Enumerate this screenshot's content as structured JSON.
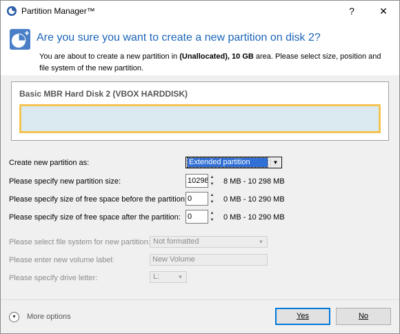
{
  "window": {
    "title": "Partition Manager™",
    "help_glyph": "?",
    "close_glyph": "✕"
  },
  "header": {
    "title": "Are you sure you want to create a new partition on disk 2?",
    "desc_prefix": "You are about to create a new partition in ",
    "desc_bold_area": "(Unallocated)",
    "desc_comma": ", ",
    "desc_bold_size": "10 GB",
    "desc_suffix": " area. Please select size, position and file system of the new partition.",
    "icon": "disk-add-icon"
  },
  "disk": {
    "label": "Basic MBR Hard Disk 2 (VBOX HARDDISK)"
  },
  "form": {
    "partition_type": {
      "label": "Create new partition as:",
      "value": "Extended partition"
    },
    "size": {
      "label": "Please specify new partition size:",
      "value": "10298",
      "range": "8 MB - 10 298 MB"
    },
    "free_before": {
      "label": "Please specify size of free space before the partition:",
      "value": "0",
      "range": "0 MB - 10 290 MB"
    },
    "free_after": {
      "label": "Please specify size of free space after the partition:",
      "value": "0",
      "range": "0 MB - 10 290 MB"
    },
    "file_system": {
      "label": "Please select file system for new partition:",
      "value": "Not formatted"
    },
    "volume_label": {
      "label": "Please enter new volume label:",
      "value": "New Volume"
    },
    "drive_letter": {
      "label": "Please specify drive letter:",
      "value": "L:"
    }
  },
  "footer": {
    "more_options": "More options",
    "yes": "Yes",
    "no": "No"
  },
  "colors": {
    "header_title": "#1a64b8",
    "disk_bar_fill": "#dbeaf1",
    "disk_bar_border": "#f3c453",
    "combo_selection": "#2f6fd6"
  }
}
